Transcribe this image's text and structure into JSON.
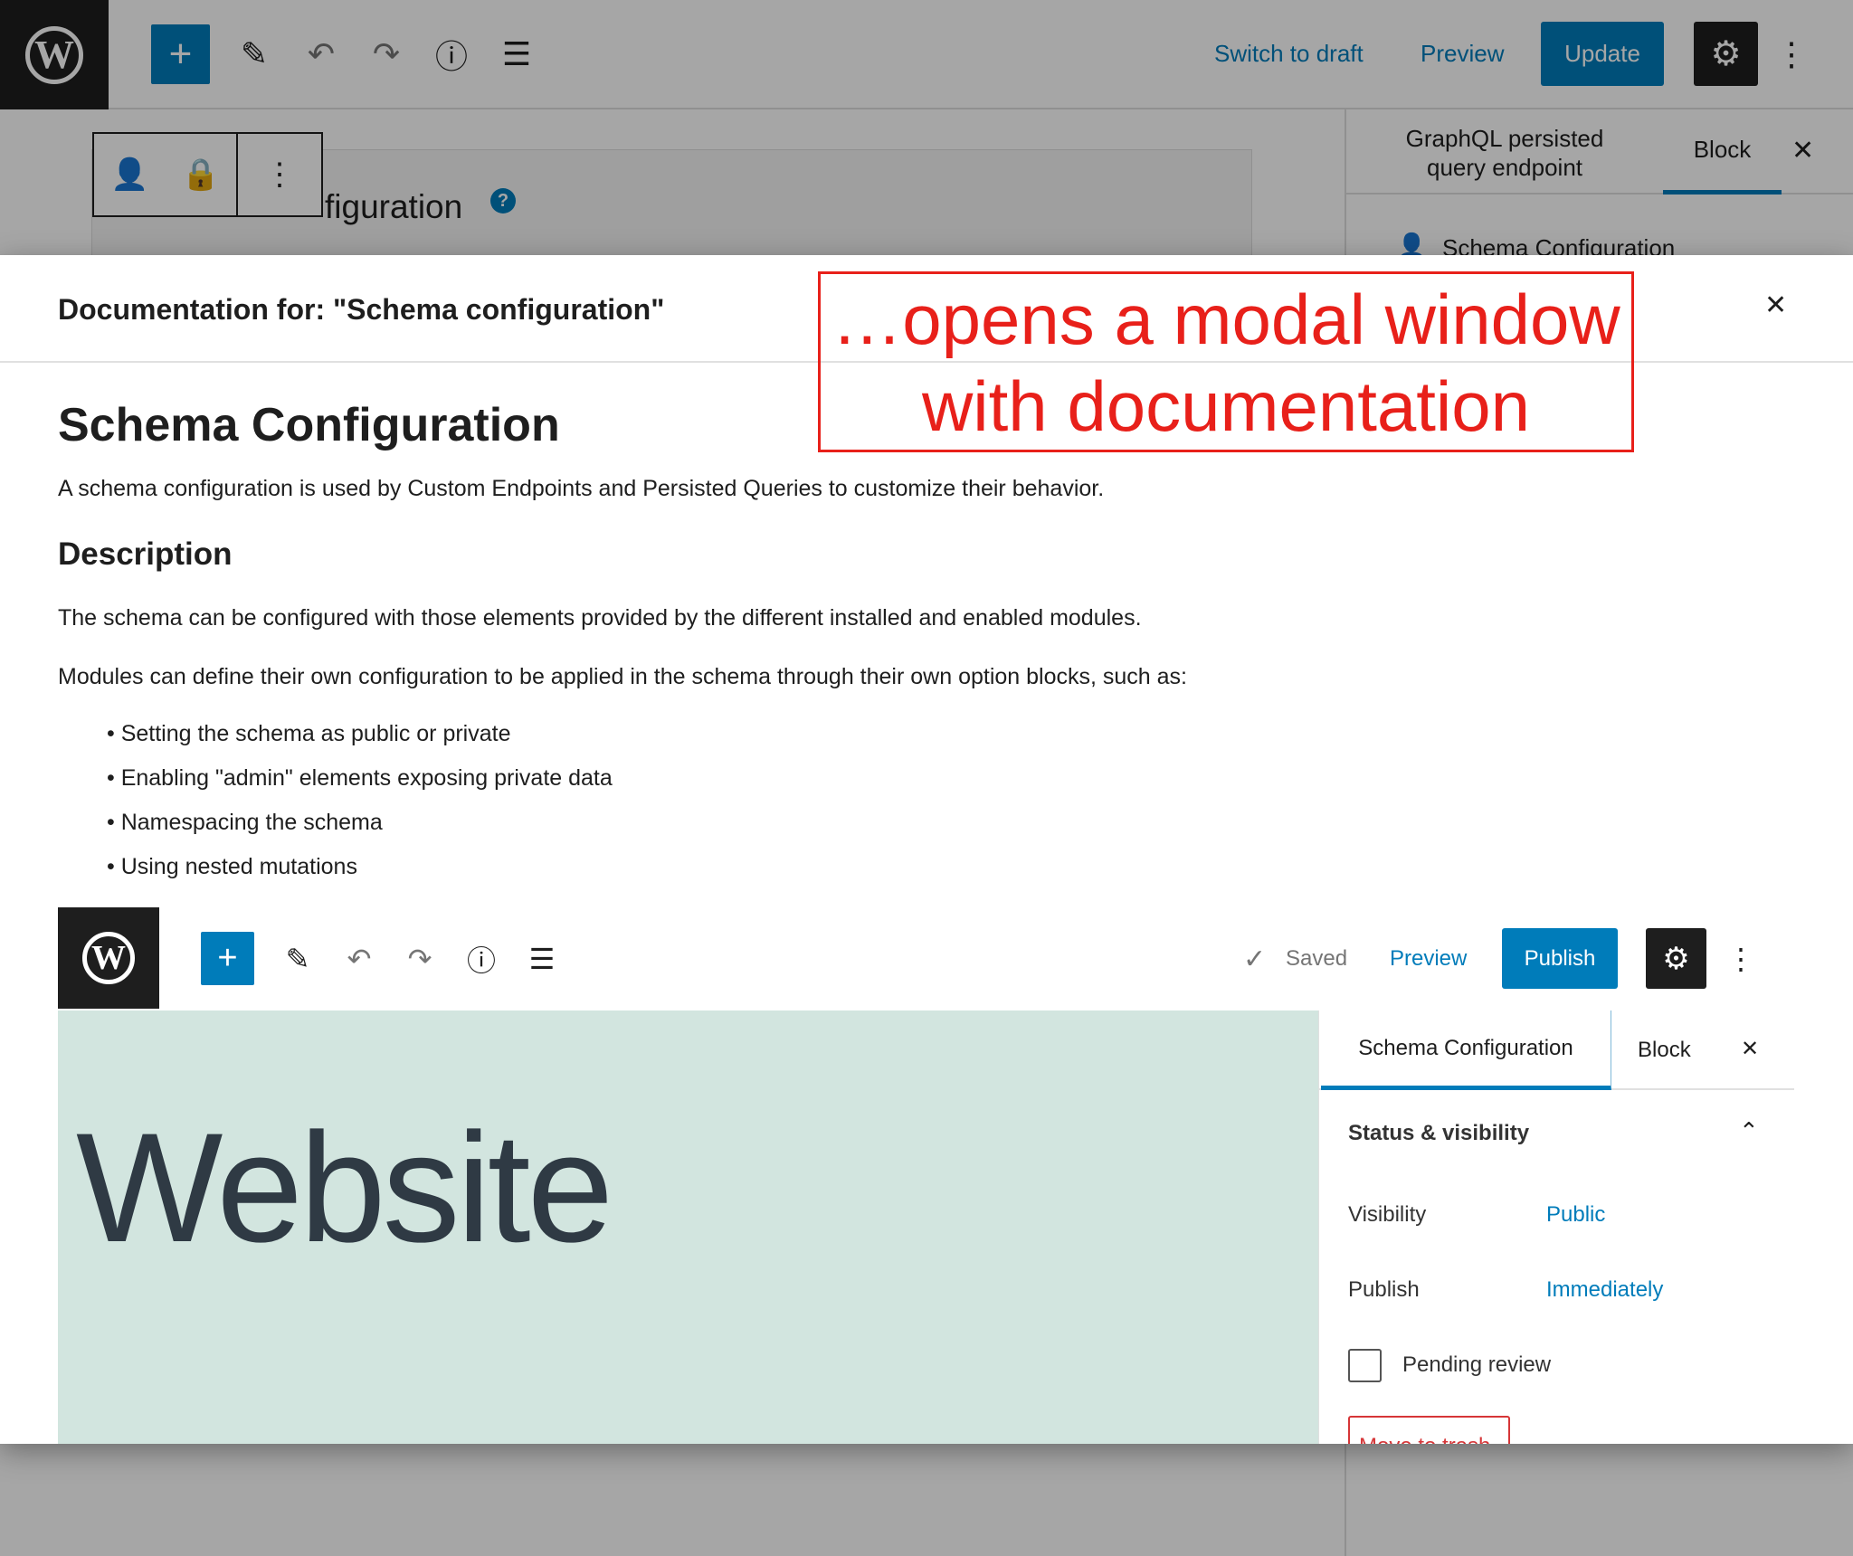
{
  "editor": {
    "topbar": {
      "switch_to_draft": "Switch to draft",
      "preview": "Preview",
      "update": "Update"
    },
    "title_partial": "figuration",
    "sidebar": {
      "tab_document": "GraphQL persisted query endpoint",
      "tab_block": "Block",
      "item": "Schema Configuration"
    }
  },
  "modal": {
    "title": "Documentation for: \"Schema configuration\"",
    "heading": "Schema Configuration",
    "intro": "A schema configuration is used by Custom Endpoints and Persisted Queries to customize their behavior.",
    "description_heading": "Description",
    "para1": "The schema can be configured with those elements provided by the different installed and enabled modules.",
    "para2": "Modules can define their own configuration to be applied in the schema through their own option blocks, such as:",
    "bullets": [
      "Setting the schema as public or private",
      "Enabling \"admin\" elements exposing private data",
      "Namespacing the schema",
      "Using nested mutations"
    ],
    "screenshot": {
      "saved": "Saved",
      "preview": "Preview",
      "publish": "Publish",
      "website_text": "Website",
      "tab_schema": "Schema Configuration",
      "tab_block": "Block",
      "panel_title": "Status & visibility",
      "visibility_label": "Visibility",
      "visibility_value": "Public",
      "publish_label": "Publish",
      "publish_value": "Immediately",
      "pending_review": "Pending review",
      "move_to_trash": "Move to trash"
    }
  },
  "annotation": {
    "line1": "…opens a modal window",
    "line2": "with documentation"
  },
  "colors": {
    "accent": "#007cba",
    "annotation": "#e8201a",
    "mint": "#d2e5df"
  }
}
